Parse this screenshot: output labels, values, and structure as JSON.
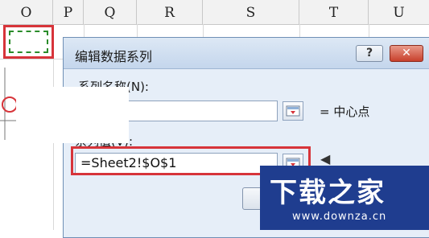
{
  "spreadsheet": {
    "columns": [
      "O",
      "P",
      "Q",
      "R",
      "S",
      "T",
      "U"
    ]
  },
  "dialog": {
    "title": "编辑数据系列",
    "help_label": "?",
    "close_label": "✕",
    "series_name_label": "系列名称(N):",
    "series_name_value": "",
    "series_name_preview": "= 中心点",
    "series_values_label": "系列值(V):",
    "series_values_value": "=Sheet2!$O$1",
    "series_values_preview": "",
    "ok_label": ""
  },
  "watermark": {
    "text": "下载之家",
    "url": "www.downza.cn"
  },
  "colors": {
    "highlight_red": "#d7343a",
    "dialog_bg": "#e6eef8",
    "watermark_bg": "#1f3d8f"
  }
}
